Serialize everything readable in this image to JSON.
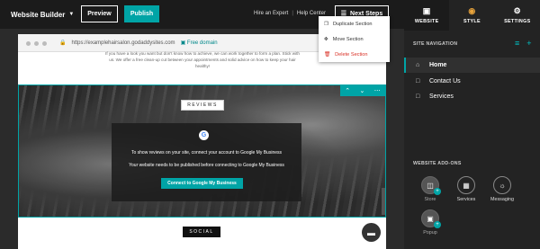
{
  "header": {
    "brand": "Website Builder",
    "preview_label": "Preview",
    "publish_label": "Publish",
    "hire_expert": "Hire an Expert",
    "separator": "|",
    "help_center": "Help Center",
    "next_steps": "Next Steps"
  },
  "browser": {
    "url": "https://examplehairsalon.godaddysites.com",
    "domain_badge": "Free domain",
    "intro_text": "If you have a look you want but don't know how to achieve, we can work together to form a plan. Stick with us. We offer a free clean-up cut between your appointments and solid advice on how to keep your hair healthy!"
  },
  "reviews_section": {
    "tag": "REVIEWS",
    "line1": "To show reviews on your site, connect your account to Google My Business",
    "line2": "Your website needs to be published before connecting to Google My Business",
    "connect_button": "Connect to Google My Business"
  },
  "context_menu": {
    "items": [
      {
        "label": "Duplicate Section",
        "icon": "duplicate-icon"
      },
      {
        "label": "Move Section",
        "icon": "move-icon"
      },
      {
        "label": "Delete Section",
        "icon": "trash-icon"
      }
    ]
  },
  "social_section": {
    "tag": "SOCIAL"
  },
  "right_panel": {
    "tabs": [
      {
        "label": "WEBSITE",
        "icon": "website-icon"
      },
      {
        "label": "STYLE",
        "icon": "palette-icon"
      },
      {
        "label": "SETTINGS",
        "icon": "gear-icon"
      }
    ],
    "site_nav_header": "SITE NAVIGATION",
    "nav_items": [
      {
        "label": "Home",
        "icon": "home-icon"
      },
      {
        "label": "Contact Us",
        "icon": "page-icon"
      },
      {
        "label": "Services",
        "icon": "page-icon"
      }
    ],
    "addons_header": "WEBSITE ADD-ONS",
    "addons": [
      {
        "label": "Store",
        "icon": "store-icon"
      },
      {
        "label": "Services",
        "icon": "calendar-icon"
      },
      {
        "label": "Messaging",
        "icon": "messaging-icon"
      },
      {
        "label": "Popup",
        "icon": "popup-icon"
      }
    ]
  },
  "colors": {
    "accent": "#00a4a6",
    "delete": "#d93025",
    "panel": "#232323",
    "topbar": "#1b1b1b"
  }
}
